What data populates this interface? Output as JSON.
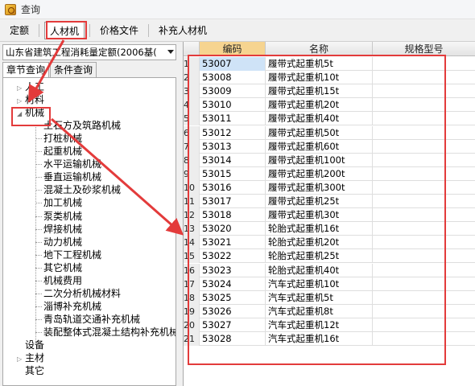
{
  "window": {
    "title": "查询"
  },
  "tabs": [
    {
      "label": "定额"
    },
    {
      "label": "人材机"
    },
    {
      "label": "价格文件"
    },
    {
      "label": "补充人材机"
    }
  ],
  "left_panel": {
    "combo_value": "山东省建筑工程消耗量定额(2006基(",
    "subtabs": [
      {
        "label": "章节查询"
      },
      {
        "label": "条件查询"
      }
    ],
    "tree": [
      {
        "label": "人工",
        "level": 0,
        "toggle": "▷"
      },
      {
        "label": "材料",
        "level": 0,
        "toggle": "▷"
      },
      {
        "label": "机械",
        "level": 0,
        "toggle": "◢"
      },
      {
        "label": "土石方及筑路机械",
        "level": 1
      },
      {
        "label": "打桩机械",
        "level": 1
      },
      {
        "label": "起重机械",
        "level": 1
      },
      {
        "label": "水平运输机械",
        "level": 1
      },
      {
        "label": "垂直运输机械",
        "level": 1
      },
      {
        "label": "混凝土及砂浆机械",
        "level": 1
      },
      {
        "label": "加工机械",
        "level": 1
      },
      {
        "label": "泵类机械",
        "level": 1
      },
      {
        "label": "焊接机械",
        "level": 1
      },
      {
        "label": "动力机械",
        "level": 1
      },
      {
        "label": "地下工程机械",
        "level": 1
      },
      {
        "label": "其它机械",
        "level": 1
      },
      {
        "label": "机械费用",
        "level": 1
      },
      {
        "label": "二次分析机械材料",
        "level": 1
      },
      {
        "label": "淄博补充机械",
        "level": 1
      },
      {
        "label": "青岛轨道交通补充机械",
        "level": 1
      },
      {
        "label": "装配整体式混凝土结构补充机械",
        "level": 1
      },
      {
        "label": "设备",
        "level": 0,
        "toggle": ""
      },
      {
        "label": "主材",
        "level": 0,
        "toggle": "▷"
      },
      {
        "label": "其它",
        "level": 0,
        "toggle": ""
      }
    ]
  },
  "grid": {
    "columns": [
      {
        "label": ""
      },
      {
        "label": "编码"
      },
      {
        "label": "名称"
      },
      {
        "label": "规格型号"
      }
    ],
    "rows": [
      {
        "n": "1",
        "code": "53007",
        "name": "履带式起重机5t"
      },
      {
        "n": "2",
        "code": "53008",
        "name": "履带式起重机10t"
      },
      {
        "n": "3",
        "code": "53009",
        "name": "履带式起重机15t"
      },
      {
        "n": "4",
        "code": "53010",
        "name": "履带式起重机20t"
      },
      {
        "n": "5",
        "code": "53011",
        "name": "履带式起重机40t"
      },
      {
        "n": "6",
        "code": "53012",
        "name": "履带式起重机50t"
      },
      {
        "n": "7",
        "code": "53013",
        "name": "履带式起重机60t"
      },
      {
        "n": "8",
        "code": "53014",
        "name": "履带式起重机100t"
      },
      {
        "n": "9",
        "code": "53015",
        "name": "履带式起重机200t"
      },
      {
        "n": "10",
        "code": "53016",
        "name": "履带式起重机300t"
      },
      {
        "n": "11",
        "code": "53017",
        "name": "履带式起重机25t"
      },
      {
        "n": "12",
        "code": "53018",
        "name": "履带式起重机30t"
      },
      {
        "n": "13",
        "code": "53020",
        "name": "轮胎式起重机16t"
      },
      {
        "n": "14",
        "code": "53021",
        "name": "轮胎式起重机20t"
      },
      {
        "n": "15",
        "code": "53022",
        "name": "轮胎式起重机25t"
      },
      {
        "n": "16",
        "code": "53023",
        "name": "轮胎式起重机40t"
      },
      {
        "n": "17",
        "code": "53024",
        "name": "汽车式起重机10t"
      },
      {
        "n": "18",
        "code": "53025",
        "name": "汽车式起重机5t"
      },
      {
        "n": "19",
        "code": "53026",
        "name": "汽车式起重机8t"
      },
      {
        "n": "20",
        "code": "53027",
        "name": "汽车式起重机12t"
      },
      {
        "n": "21",
        "code": "53028",
        "name": "汽车式起重机16t"
      }
    ]
  },
  "annotation_color": "#e33b3b"
}
